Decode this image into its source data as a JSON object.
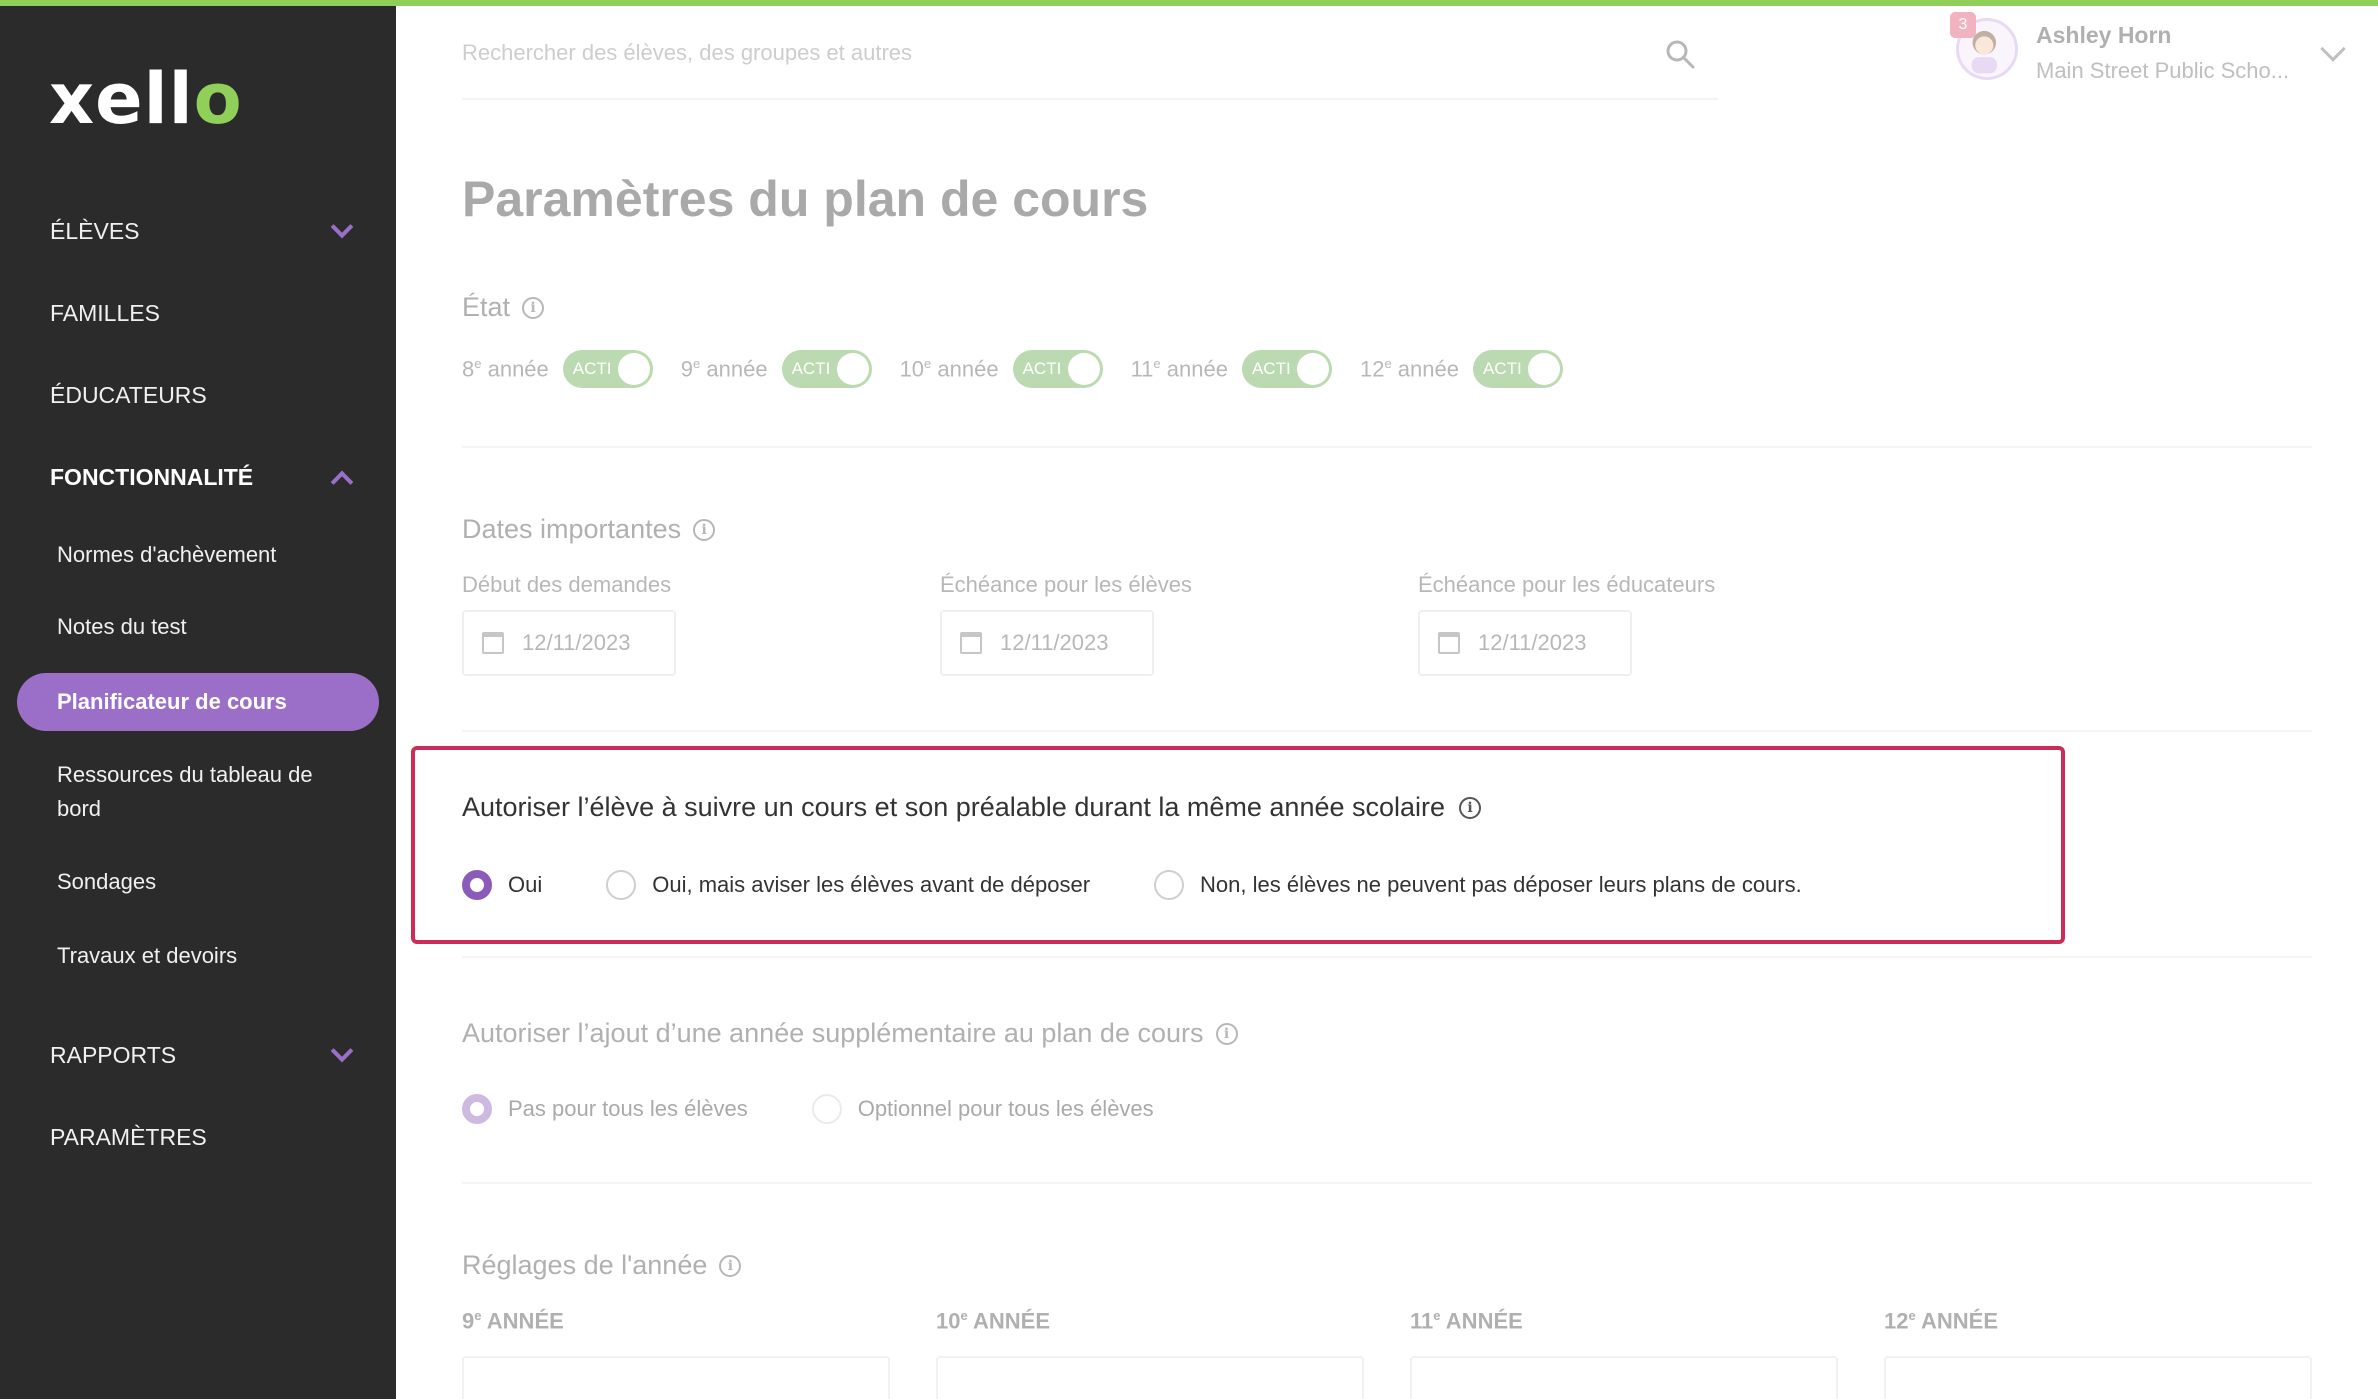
{
  "sidebar": {
    "logo": "xello",
    "items": [
      {
        "label": "ÉLÈVES"
      },
      {
        "label": "FAMILLES"
      },
      {
        "label": "ÉDUCATEURS"
      },
      {
        "label": "FONCTIONNALITÉ"
      },
      {
        "label": "RAPPORTS"
      },
      {
        "label": "PARAMÈTRES"
      }
    ],
    "sub_items": [
      {
        "label": "Normes d'achèvement"
      },
      {
        "label": "Notes du test"
      },
      {
        "label": "Planificateur de cours"
      },
      {
        "label": "Ressources du tableau de bord"
      },
      {
        "label": "Sondages"
      },
      {
        "label": "Travaux et devoirs"
      }
    ]
  },
  "header": {
    "search_placeholder": "Rechercher des élèves, des groupes et autres",
    "notification_count": "3",
    "user_name": "Ashley Horn",
    "user_school": "Main Street Public Scho..."
  },
  "page": {
    "title": "Paramètres du plan de cours",
    "state": {
      "title": "État",
      "grades": [
        {
          "num": "8",
          "sup": "e",
          "suffix": " année",
          "toggle": "ACTI"
        },
        {
          "num": "9",
          "sup": "e",
          "suffix": " année",
          "toggle": "ACTI"
        },
        {
          "num": "10",
          "sup": "e",
          "suffix": " année",
          "toggle": "ACTI"
        },
        {
          "num": "11",
          "sup": "e",
          "suffix": " année",
          "toggle": "ACTI"
        },
        {
          "num": "12",
          "sup": "e",
          "suffix": " année",
          "toggle": "ACTI"
        }
      ]
    },
    "dates": {
      "title": "Dates importantes",
      "fields": [
        {
          "label": "Début des demandes",
          "value": "12/11/2023"
        },
        {
          "label": "Échéance pour les élèves",
          "value": "12/11/2023"
        },
        {
          "label": "Échéance pour les éducateurs",
          "value": "12/11/2023"
        }
      ]
    },
    "prereq": {
      "title": "Autoriser l’élève à suivre un cours et son préalable durant la même année scolaire",
      "options": [
        {
          "label": "Oui",
          "selected": true
        },
        {
          "label": "Oui, mais aviser les élèves avant de déposer",
          "selected": false
        },
        {
          "label": "Non, les élèves ne peuvent pas déposer leurs plans de cours.",
          "selected": false
        }
      ]
    },
    "extra_year": {
      "title": "Autoriser l’ajout d’une année supplémentaire au plan de cours",
      "options": [
        {
          "label": "Pas pour tous les élèves",
          "selected": true
        },
        {
          "label": "Optionnel pour tous les élèves",
          "selected": false
        }
      ]
    },
    "year_settings": {
      "title": "Réglages de l'année",
      "years": [
        {
          "num": "9",
          "sup": "e",
          "suffix": " ANNÉE"
        },
        {
          "num": "10",
          "sup": "e",
          "suffix": " ANNÉE"
        },
        {
          "num": "11",
          "sup": "e",
          "suffix": " ANNÉE"
        },
        {
          "num": "12",
          "sup": "e",
          "suffix": " ANNÉE"
        }
      ]
    }
  },
  "colors": {
    "accent": "#9b6fc8",
    "toggle_on": "#5fa845",
    "highlight_border": "#cc2c58",
    "sidebar_bg": "#2b2b2b"
  }
}
